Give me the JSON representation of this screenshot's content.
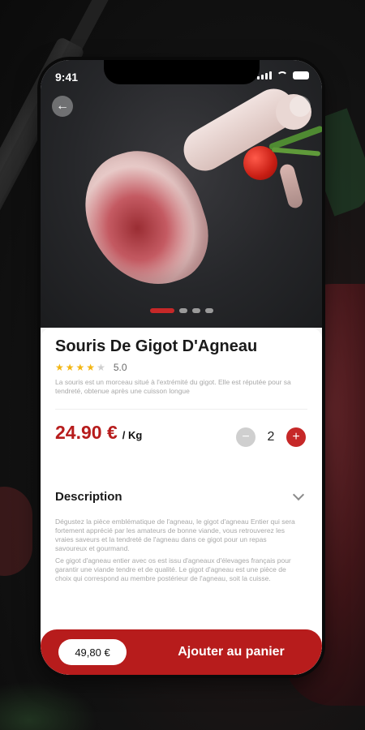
{
  "status": {
    "time": "9:41"
  },
  "product": {
    "title": "Souris De Gigot D'Agneau",
    "rating": {
      "value": "5.0",
      "stars_filled": 4,
      "stars_total": 5
    },
    "short_description": "La souris est un morceau situé à l'extrémité du gigot. Elle est réputée pour sa tendreté, obtenue après une cuisson longue",
    "price": "24.90 €",
    "price_unit": "/ Kg",
    "quantity": "2"
  },
  "description": {
    "label": "Description",
    "paragraph1": "Dégustez la pièce emblématique de l'agneau, le gigot d'agneau Entier qui sera fortement apprécié par les amateurs de bonne viande, vous retrouverez les vraies saveurs et la tendreté de l'agneau dans ce gigot pour un repas savoureux et gourmand.",
    "paragraph2": "Ce gigot d'agneau entier avec os est issu d'agneaux d'élevages français pour garantir une viande tendre et de qualité. Le gigot d'agneau est une pièce de choix qui correspond au membre postérieur de l'agneau, soit la cuisse."
  },
  "cart": {
    "total": "49,80 €",
    "button_label": "Ajouter au panier"
  },
  "gallery": {
    "slides": 4,
    "active": 0
  },
  "colors": {
    "accent": "#c62828",
    "bar": "#b71c1c",
    "star": "#f3b614"
  }
}
